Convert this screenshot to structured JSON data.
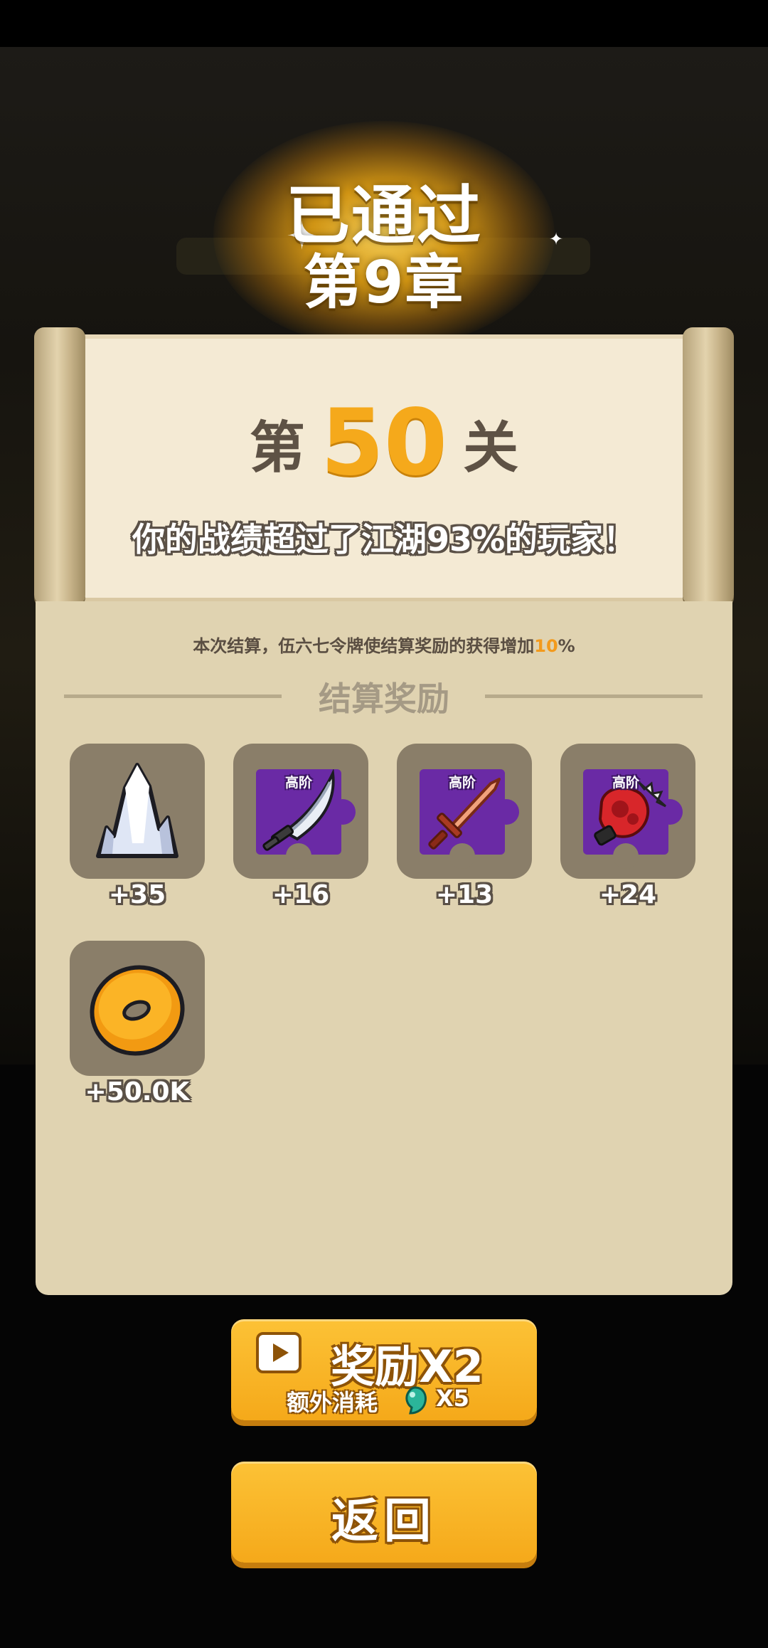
{
  "header": {
    "title_line1": "已通过",
    "title_line2": "第9章"
  },
  "level": {
    "prefix": "第",
    "number": "50",
    "suffix": "关",
    "beat_text": "你的战绩超过了江湖93%的玩家！"
  },
  "bonus": {
    "text": "本次结算，伍六七令牌使结算奖励的获得增加",
    "percent": "10",
    "percent_sign": "%"
  },
  "rewards_section": {
    "title": "结算奖励",
    "items": [
      {
        "icon": "crystal-icon",
        "count": "+35"
      },
      {
        "icon": "saber-fragment-icon",
        "tier": "高阶",
        "count": "+16"
      },
      {
        "icon": "sword-fragment-icon",
        "tier": "高阶",
        "count": "+13"
      },
      {
        "icon": "gauntlet-fragment-icon",
        "tier": "高阶",
        "count": "+24"
      },
      {
        "icon": "coin-icon",
        "count": "+50.0K"
      }
    ]
  },
  "buttons": {
    "double_reward_label": "奖励X2",
    "extra_cost_label": "额外消耗",
    "cost_amount": "X5",
    "back_label": "返回"
  },
  "colors": {
    "accent_orange": "#f5a91b",
    "button_yellow": "#fcc236",
    "panel_beige": "#e0d3b1",
    "fragment_purple": "#6a2aa5"
  }
}
